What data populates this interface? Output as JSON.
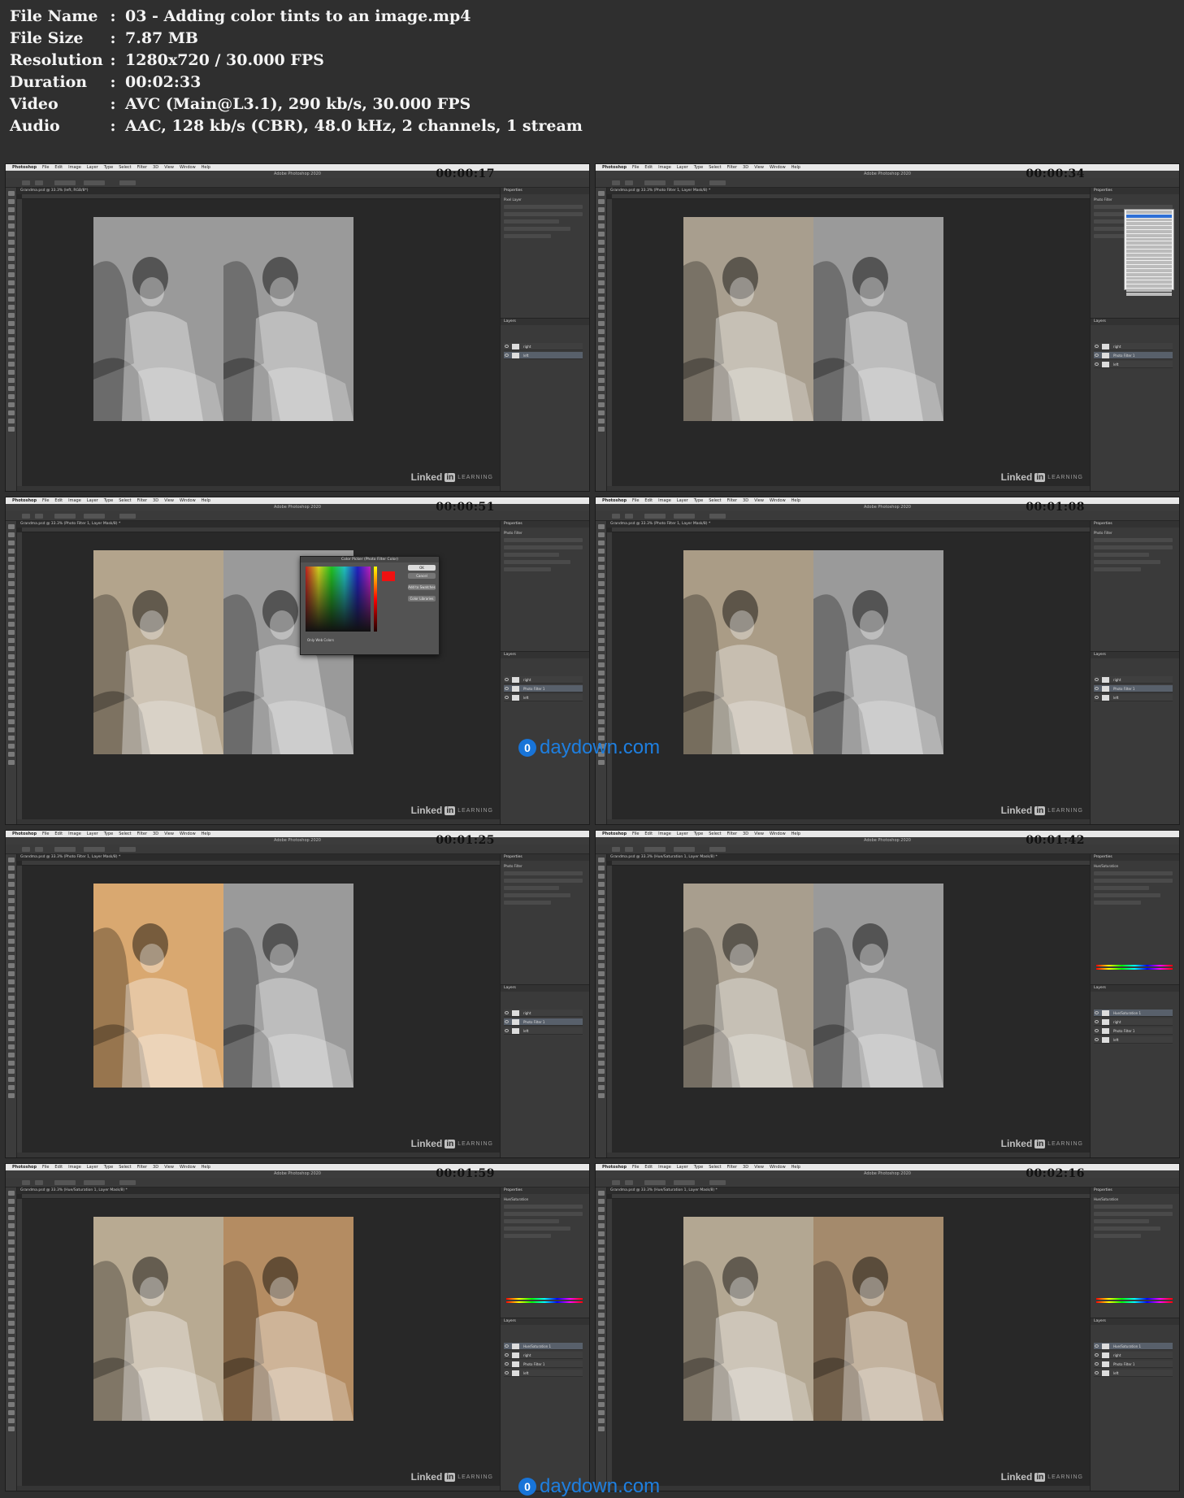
{
  "file_info": [
    {
      "key": "File Name",
      "sep": ":",
      "value": "03 - Adding color tints to an image.mp4"
    },
    {
      "key": "File Size",
      "sep": ":",
      "value": "7.87 MB"
    },
    {
      "key": "Resolution",
      "sep": ":",
      "value": "1280x720 / 30.000 FPS"
    },
    {
      "key": "Duration",
      "sep": ":",
      "value": "00:02:33"
    },
    {
      "key": "Video",
      "sep": ":",
      "value": "AVC (Main@L3.1), 290 kb/s, 30.000 FPS"
    },
    {
      "key": "Audio",
      "sep": ":",
      "value": "AAC, 128 kb/s (CBR), 48.0 kHz, 2 channels, 1 stream"
    }
  ],
  "app": {
    "menu": [
      "Photoshop",
      "File",
      "Edit",
      "Image",
      "Layer",
      "Type",
      "Select",
      "Filter",
      "3D",
      "View",
      "Window",
      "Help"
    ],
    "window_title": "Adobe Photoshop 2020",
    "watermark_linked": "Linked",
    "watermark_in": "in",
    "watermark_learning": "LEARNING",
    "properties_label": "Properties",
    "layers_label": "Layers"
  },
  "site_watermark": {
    "badge": "0",
    "text": "daydown.com"
  },
  "frames": [
    {
      "timestamp": "00:00:17",
      "tab": "Grandma.psd @ 33.3% (left, RGB/8*)",
      "left_tint": "#9a9a9a",
      "right_tint": "#9a9a9a",
      "panel_title": "Pixel Layer",
      "layers": [
        "right",
        "left"
      ],
      "selected_layer": 1
    },
    {
      "timestamp": "00:00:34",
      "tab": "Grandma.psd @ 33.3% (Photo Filter 1, Layer Mask/8) *",
      "left_tint": "#a89e8e",
      "right_tint": "#9a9a9a",
      "panel_title": "Photo Filter",
      "layers": [
        "right",
        "Photo Filter 1",
        "left"
      ],
      "selected_layer": 1,
      "overlay": "filter-menu"
    },
    {
      "timestamp": "00:00:51",
      "tab": "Grandma.psd @ 33.3% (Photo Filter 1, Layer Mask/8) *",
      "left_tint": "#b3a48c",
      "right_tint": "#9a9a9a",
      "panel_title": "Photo Filter",
      "layers": [
        "right",
        "Photo Filter 1",
        "left"
      ],
      "selected_layer": 1,
      "overlay": "color-picker",
      "dialog": {
        "title": "Color Picker (Photo Filter Color)",
        "ok": "OK",
        "cancel": "Cancel",
        "add": "Add to Swatches",
        "libraries": "Color Libraries",
        "only_web": "Only Web Colors"
      }
    },
    {
      "timestamp": "00:01:08",
      "tab": "Grandma.psd @ 33.3% (Photo Filter 1, Layer Mask/8) *",
      "left_tint": "#aa9c86",
      "right_tint": "#9a9a9a",
      "panel_title": "Photo Filter",
      "layers": [
        "right",
        "Photo Filter 1",
        "left"
      ],
      "selected_layer": 1
    },
    {
      "timestamp": "00:01:25",
      "tab": "Grandma.psd @ 33.3% (Photo Filter 1, Layer Mask/8) *",
      "left_tint": "#d9a870",
      "right_tint": "#9a9a9a",
      "panel_title": "Photo Filter",
      "layers": [
        "right",
        "Photo Filter 1",
        "left"
      ],
      "selected_layer": 1
    },
    {
      "timestamp": "00:01:42",
      "tab": "Grandma.psd @ 33.3% (Hue/Saturation 1, Layer Mask/8) *",
      "left_tint": "#a89e8e",
      "right_tint": "#9a9a9a",
      "panel_title": "Hue/Saturation",
      "layers": [
        "Hue/Saturation 1",
        "right",
        "Photo Filter 1",
        "left"
      ],
      "selected_layer": 0,
      "overlay": "hue-bars"
    },
    {
      "timestamp": "00:01:59",
      "tab": "Grandma.psd @ 33.3% (Hue/Saturation 1, Layer Mask/8) *",
      "left_tint": "#b8aa92",
      "right_tint": "#b48c62",
      "panel_title": "Hue/Saturation",
      "layers": [
        "Hue/Saturation 1",
        "right",
        "Photo Filter 1",
        "left"
      ],
      "selected_layer": 0,
      "overlay": "hue-bars"
    },
    {
      "timestamp": "00:02:16",
      "tab": "Grandma.psd @ 33.3% (Hue/Saturation 1, Layer Mask/8) *",
      "left_tint": "#b3a792",
      "right_tint": "#a48a6c",
      "panel_title": "Hue/Saturation",
      "layers": [
        "Hue/Saturation 1",
        "right",
        "Photo Filter 1",
        "left"
      ],
      "selected_layer": 0,
      "overlay": "hue-bars"
    }
  ]
}
